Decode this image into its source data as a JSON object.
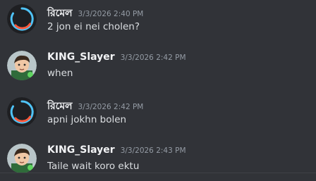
{
  "messages": [
    {
      "username": "রিমেল",
      "timestamp": "3/3/2026 2:40 PM",
      "text": "2 jon ei nei cholen?",
      "avatar": "ring-icon"
    },
    {
      "username": "KING_Slayer",
      "timestamp": "3/3/2026 2:42 PM",
      "text": "when",
      "avatar": "cartoon-boy-icon"
    },
    {
      "username": "রিমেল",
      "timestamp": "3/3/2026 2:42 PM",
      "text": "apni jokhn bolen",
      "avatar": "ring-icon"
    },
    {
      "username": "KING_Slayer",
      "timestamp": "3/3/2026 2:43 PM",
      "text": "Taile wait koro ektu",
      "avatar": "cartoon-boy-icon"
    }
  ],
  "colors": {
    "background": "#313338",
    "username": "#f2f3f5",
    "timestamp": "#949ba4",
    "text": "#dbdee1"
  }
}
